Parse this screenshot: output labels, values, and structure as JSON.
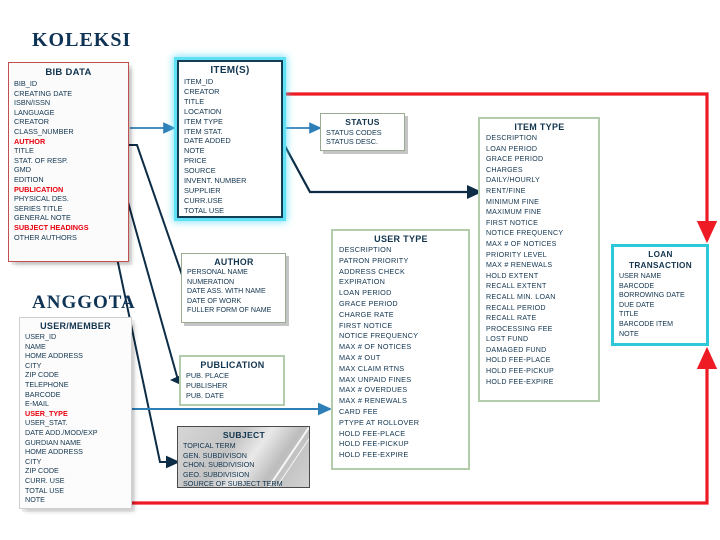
{
  "page": {
    "background": "#ffffff",
    "text_color": "#12354f",
    "highlight_color": "#e8000d",
    "red_link_color": "#ee1b24",
    "blue_link_color": "#2e7fb8",
    "navy_link_color": "#0d2c45"
  },
  "sections": {
    "koleksi": "KOLEKSI",
    "anggota": "ANGGOTA"
  },
  "entities": {
    "bib_data": {
      "title": "BIB DATA",
      "fields": [
        {
          "label": "BIB_ID",
          "highlight": false
        },
        {
          "label": "CREATING DATE",
          "highlight": false
        },
        {
          "label": "ISBN/ISSN",
          "highlight": false
        },
        {
          "label": "LANGUAGE",
          "highlight": false
        },
        {
          "label": "CREATOR",
          "highlight": false
        },
        {
          "label": "CLASS_NUMBER",
          "highlight": false
        },
        {
          "label": "AUTHOR",
          "highlight": true
        },
        {
          "label": "TITLE",
          "highlight": false
        },
        {
          "label": "STAT. OF RESP.",
          "highlight": false
        },
        {
          "label": "GMD",
          "highlight": false
        },
        {
          "label": "EDITION",
          "highlight": false
        },
        {
          "label": "PUBLICATION",
          "highlight": true
        },
        {
          "label": "PHYSICAL DES.",
          "highlight": false
        },
        {
          "label": "SERIES TITLE",
          "highlight": false
        },
        {
          "label": "GENERAL NOTE",
          "highlight": false
        },
        {
          "label": "SUBJECT HEADINGS",
          "highlight": true
        },
        {
          "label": "OTHER AUTHORS",
          "highlight": false
        }
      ]
    },
    "items": {
      "title": "ITEM(S)",
      "fields": [
        {
          "label": "ITEM_ID",
          "highlight": false
        },
        {
          "label": "CREATOR",
          "highlight": false
        },
        {
          "label": "TITLE",
          "highlight": false
        },
        {
          "label": "LOCATION",
          "highlight": false
        },
        {
          "label": "ITEM TYPE",
          "highlight": false
        },
        {
          "label": "ITEM STAT.",
          "highlight": false
        },
        {
          "label": "DATE ADDED",
          "highlight": false
        },
        {
          "label": "NOTE",
          "highlight": false
        },
        {
          "label": "PRICE",
          "highlight": false
        },
        {
          "label": "SOURCE",
          "highlight": false
        },
        {
          "label": "INVENT. NUMBER",
          "highlight": false
        },
        {
          "label": "SUPPLIER",
          "highlight": false
        },
        {
          "label": "CURR.USE",
          "highlight": false
        },
        {
          "label": "TOTAL USE",
          "highlight": false
        }
      ]
    },
    "status": {
      "title": "STATUS",
      "fields": [
        {
          "label": "STATUS CODES",
          "highlight": false
        },
        {
          "label": "STATUS DESC.",
          "highlight": false
        }
      ]
    },
    "item_type": {
      "title": "ITEM TYPE",
      "fields": [
        {
          "label": "DESCRIPTION",
          "highlight": false
        },
        {
          "label": "LOAN PERIOD",
          "highlight": false
        },
        {
          "label": "GRACE PERIOD",
          "highlight": false
        },
        {
          "label": "CHARGES",
          "highlight": false
        },
        {
          "label": "DAILY/HOURLY",
          "highlight": false
        },
        {
          "label": "RENT/FINE",
          "highlight": false
        },
        {
          "label": "MINIMUM FINE",
          "highlight": false
        },
        {
          "label": "MAXIMUM FINE",
          "highlight": false
        },
        {
          "label": "FIRST NOTICE",
          "highlight": false
        },
        {
          "label": "NOTICE FREQUENCY",
          "highlight": false
        },
        {
          "label": "MAX # OF NOTICES",
          "highlight": false
        },
        {
          "label": "PRIORITY LEVEL",
          "highlight": false
        },
        {
          "label": "MAX # RENEWALS",
          "highlight": false
        },
        {
          "label": "HOLD EXTENT",
          "highlight": false
        },
        {
          "label": "RECALL EXTENT",
          "highlight": false
        },
        {
          "label": "RECALL MIN. LOAN",
          "highlight": false
        },
        {
          "label": "RECALL PERIOD",
          "highlight": false
        },
        {
          "label": "RECALL RATE",
          "highlight": false
        },
        {
          "label": "PROCESSING FEE",
          "highlight": false
        },
        {
          "label": "LOST FUND",
          "highlight": false
        },
        {
          "label": "DAMAGED FUND",
          "highlight": false
        },
        {
          "label": "HOLD FEE-PLACE",
          "highlight": false
        },
        {
          "label": "HOLD FEE-PICKUP",
          "highlight": false
        },
        {
          "label": "HOLD FEE-EXPIRE",
          "highlight": false
        }
      ]
    },
    "user_type": {
      "title": "USER TYPE",
      "fields": [
        {
          "label": "DESCRIPTION",
          "highlight": false
        },
        {
          "label": "PATRON PRIORITY",
          "highlight": false
        },
        {
          "label": "ADDRESS CHECK",
          "highlight": false
        },
        {
          "label": "EXPIRATION",
          "highlight": false
        },
        {
          "label": "LOAN PERIOD",
          "highlight": false
        },
        {
          "label": "GRACE PERIOD",
          "highlight": false
        },
        {
          "label": "CHARGE RATE",
          "highlight": false
        },
        {
          "label": "FIRST NOTICE",
          "highlight": false
        },
        {
          "label": "NOTICE FREQUENCY",
          "highlight": false
        },
        {
          "label": "MAX # OF NOTICES",
          "highlight": false
        },
        {
          "label": "MAX # OUT",
          "highlight": false
        },
        {
          "label": "MAX CLAIM RTNS",
          "highlight": false
        },
        {
          "label": "MAX UNPAID FINES",
          "highlight": false
        },
        {
          "label": "MAX # OVERDUES",
          "highlight": false
        },
        {
          "label": "MAX # RENEWALS",
          "highlight": false
        },
        {
          "label": "CARD FEE",
          "highlight": false
        },
        {
          "label": "PTYPE AT ROLLOVER",
          "highlight": false
        },
        {
          "label": "HOLD FEE-PLACE",
          "highlight": false
        },
        {
          "label": "HOLD FEE-PICKUP",
          "highlight": false
        },
        {
          "label": "HOLD FEE-EXPIRE",
          "highlight": false
        }
      ]
    },
    "loan_transaction": {
      "title_line1": "LOAN",
      "title_line2": "TRANSACTION",
      "fields": [
        {
          "label": "USER NAME",
          "highlight": false
        },
        {
          "label": "BARCODE",
          "highlight": false
        },
        {
          "label": "BORROWING DATE",
          "highlight": false
        },
        {
          "label": "DUE DATE",
          "highlight": false
        },
        {
          "label": "TITLE",
          "highlight": false
        },
        {
          "label": "BARCODE ITEM",
          "highlight": false
        },
        {
          "label": "NOTE",
          "highlight": false
        }
      ]
    },
    "author": {
      "title": "AUTHOR",
      "fields": [
        {
          "label": "PERSONAL NAME",
          "highlight": false
        },
        {
          "label": "NUMERATION",
          "highlight": false
        },
        {
          "label": "DATE ASS. WITH NAME",
          "highlight": false
        },
        {
          "label": "DATE OF WORK",
          "highlight": false
        },
        {
          "label": "FULLER FORM OF NAME",
          "highlight": false
        }
      ]
    },
    "publication": {
      "title": "PUBLICATION",
      "fields": [
        {
          "label": "PUB. PLACE",
          "highlight": false
        },
        {
          "label": "PUBLISHER",
          "highlight": false
        },
        {
          "label": "PUB. DATE",
          "highlight": false
        }
      ]
    },
    "subject": {
      "title": "SUBJECT",
      "fields": [
        {
          "label": "TOPICAL TERM",
          "highlight": false
        },
        {
          "label": "GEN. SUBDIVISON",
          "highlight": false
        },
        {
          "label": "CHON. SUBDIVISION",
          "highlight": false
        },
        {
          "label": "GEO. SUBDIVISION",
          "highlight": false
        },
        {
          "label": "SOURCE OF  SUBJECT TERM",
          "highlight": false
        }
      ]
    },
    "user_member": {
      "title": "USER/MEMBER",
      "fields": [
        {
          "label": "USER_ID",
          "highlight": false
        },
        {
          "label": "NAME",
          "highlight": false
        },
        {
          "label": "HOME ADDRESS",
          "highlight": false
        },
        {
          "label": "CITY",
          "highlight": false
        },
        {
          "label": "ZIP CODE",
          "highlight": false
        },
        {
          "label": "TELEPHONE",
          "highlight": false
        },
        {
          "label": "BARCODE",
          "highlight": false
        },
        {
          "label": "E-MAIL",
          "highlight": false
        },
        {
          "label": "USER_TYPE",
          "highlight": true
        },
        {
          "label": "USER_STAT.",
          "highlight": false
        },
        {
          "label": "DATE ADD./MOD/EXP",
          "highlight": false
        },
        {
          "label": "GURDIAN NAME",
          "highlight": false
        },
        {
          "label": "HOME ADDRESS",
          "highlight": false
        },
        {
          "label": "CITY",
          "highlight": false
        },
        {
          "label": "ZIP CODE",
          "highlight": false
        },
        {
          "label": "CURR. USE",
          "highlight": false
        },
        {
          "label": "TOTAL USE",
          "highlight": false
        },
        {
          "label": "NOTE",
          "highlight": false
        }
      ]
    }
  }
}
